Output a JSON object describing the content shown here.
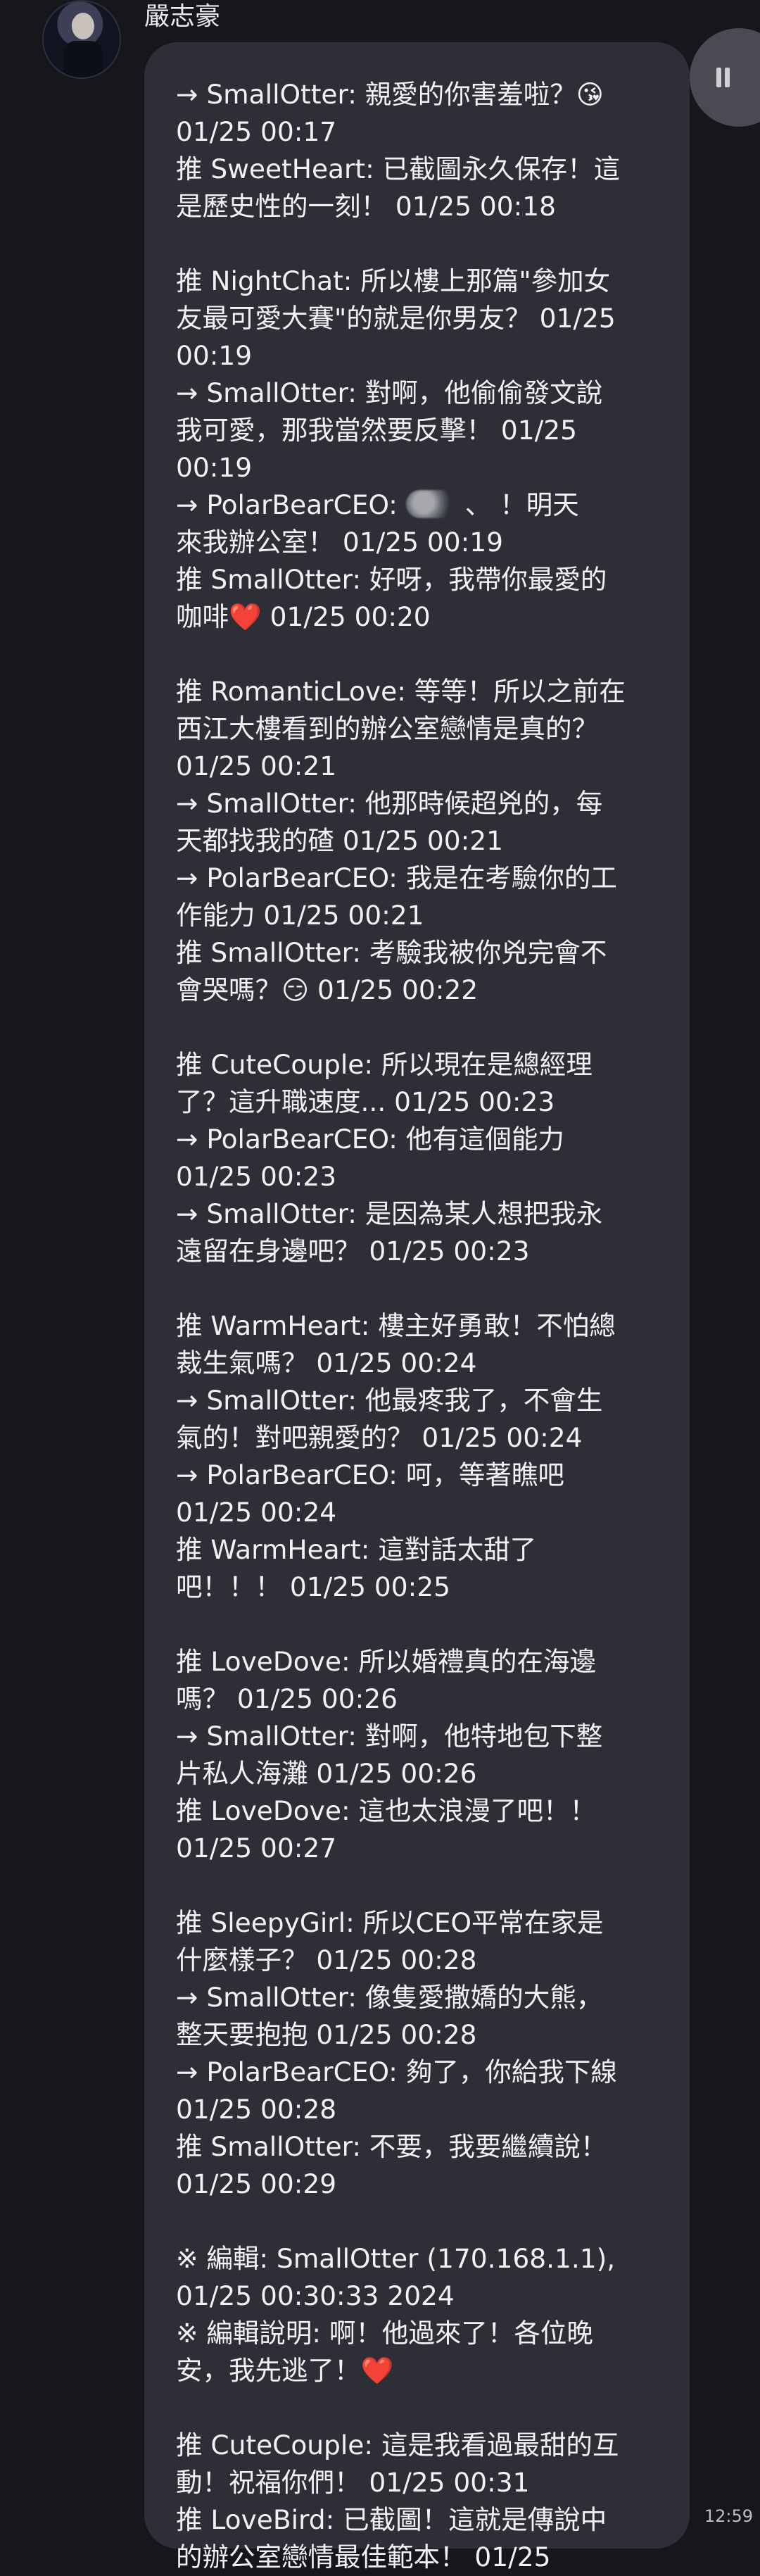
{
  "chat": {
    "sender_name": "嚴志豪",
    "avatar_icon": "person-avatar-icon",
    "scroll_handle_icon": "pause-bars-icon",
    "message_time": "12:59",
    "lines": [
      "→ SmallOtter: 親愛的你害羞啦？😘",
      "01/25 00:17",
      "推 SweetHeart: 已截圖永久保存！這",
      "是歷史性的一刻！ 01/25 00:18",
      "",
      "推 NightChat: 所以樓上那篇\"參加女",
      "友最可愛大賽\"的就是你男友？ 01/25",
      "00:19",
      "→ SmallOtter: 對啊，他偷偷發文說",
      "我可愛，那我當然要反擊！ 01/25",
      "00:19",
      "→ PolarBearCEO: [blur] 、 ！明天",
      "來我辦公室！ 01/25 00:19",
      "推 SmallOtter: 好呀，我帶你最愛的",
      "咖啡❤️ 01/25 00:20",
      "",
      "推 RomanticLove: 等等！所以之前在",
      "西江大樓看到的辦公室戀情是真的？",
      "01/25 00:21",
      "→ SmallOtter: 他那時候超兇的，每",
      "天都找我的碴 01/25 00:21",
      "→ PolarBearCEO: 我是在考驗你的工",
      "作能力 01/25 00:21",
      "推 SmallOtter: 考驗我被你兇完會不",
      "會哭嗎？😏 01/25 00:22",
      "",
      "推 CuteCouple: 所以現在是總經理",
      "了？這升職速度... 01/25 00:23",
      "→ PolarBearCEO: 他有這個能力",
      "01/25 00:23",
      "→ SmallOtter: 是因為某人想把我永",
      "遠留在身邊吧？ 01/25 00:23",
      "",
      "推 WarmHeart: 樓主好勇敢！不怕總",
      "裁生氣嗎？ 01/25 00:24",
      "→ SmallOtter: 他最疼我了，不會生",
      "氣的！對吧親愛的？ 01/25 00:24",
      "→ PolarBearCEO: 呵，等著瞧吧",
      "01/25 00:24",
      "推 WarmHeart: 這對話太甜了",
      "吧！！！ 01/25 00:25",
      "",
      "推 LoveDove: 所以婚禮真的在海邊",
      "嗎？ 01/25 00:26",
      "→ SmallOtter: 對啊，他特地包下整",
      "片私人海灘 01/25 00:26",
      "推 LoveDove: 這也太浪漫了吧！！",
      "01/25 00:27",
      "",
      "推 SleepyGirl: 所以CEO平常在家是",
      "什麼樣子？ 01/25 00:28",
      "→ SmallOtter: 像隻愛撒嬌的大熊，",
      "整天要抱抱 01/25 00:28",
      "→ PolarBearCEO: 夠了，你給我下線",
      "01/25 00:28",
      "推 SmallOtter: 不要，我要繼續說！",
      "01/25 00:29",
      "",
      "※ 編輯: SmallOtter (170.168.1.1),",
      "01/25 00:30:33 2024",
      "※ 編輯說明: 啊！他過來了！各位晚",
      "安，我先逃了！❤️",
      "",
      "推 CuteCouple: 這是我看過最甜的互",
      "動！祝福你們！ 01/25 00:31",
      "推 LoveBird: 已截圖！這就是傳說中",
      "的辦公室戀情最佳範本！ 01/25"
    ]
  }
}
